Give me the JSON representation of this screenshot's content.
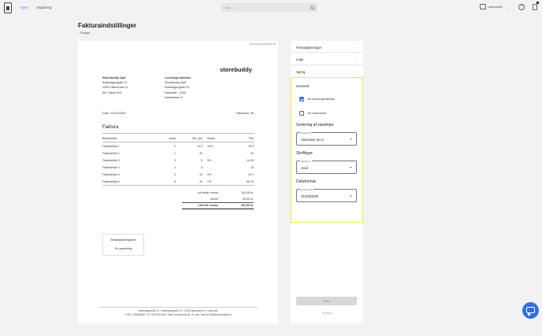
{
  "nav": {
    "home": "Hjem",
    "bookkeeping": "Bogføring",
    "search_placeholder": "Søg....",
    "user": "rasmus98"
  },
  "page": {
    "title": "Fakturaindstillinger",
    "back": "Tilbage"
  },
  "preview": {
    "download_label": "Download preview",
    "brand": "storebuddy",
    "sender": [
      "Storebuddy ApS",
      "Købmagergade 22",
      "1150 København K",
      "Att. Lasse Kirk"
    ],
    "delivery_title": "Leverings adresse",
    "delivery": [
      "Storebuddy ApS",
      "Købmagergade 22",
      "Danmark - 1150",
      "København K"
    ],
    "date": "Dato: 21/12/2025",
    "invoice_no": "Fakturanr. 45",
    "heading": "Faktura",
    "columns": [
      "Beskrivelse",
      "Antal",
      "Stk. pris",
      "Rabat",
      "Pris"
    ],
    "rows": [
      [
        "Fakturalinje 1",
        "2",
        "10.5",
        "10%",
        "18.9"
      ],
      [
        "Fakturalinje 2",
        "1",
        "20",
        "",
        "20"
      ],
      [
        "Fakturalinje 3",
        "3",
        "5",
        "5%",
        "14.25"
      ],
      [
        "Fakturalinje 4",
        "2",
        "5",
        "",
        "10"
      ],
      [
        "Fakturalinje 5",
        "3",
        "10",
        "3%",
        "29.1"
      ],
      [
        "Fakturalinje 6",
        "5",
        "15",
        "7%",
        "69.75"
      ]
    ],
    "totals": [
      {
        "label": "I alt ekskl. moms",
        "value": "162,00 kr."
      },
      {
        "label": "Moms",
        "value": "40,50 kr."
      },
      {
        "label": "I alt inkl. moms",
        "value": "202,50 kr."
      }
    ],
    "terms_title": "Betalingsbetingelser",
    "terms_link": "Se opsætning",
    "footer_line1": "Købmagergade 22 / Købmagergade 22 / 1150 København K / Danmark",
    "footer_line2": "CVR nr 36896668 / Tlf +4527621654 / Web: storebuddy.dk / E-mail: rasmus+98@storebuddy.dk"
  },
  "settings": {
    "sections": [
      "Firmaoplysninger",
      "Logo",
      "Sprog"
    ],
    "general": "Generelt",
    "checkboxes": [
      {
        "label": "Vis leveringsadresse",
        "checked": true
      },
      {
        "label": "Vis varenumre",
        "checked": false
      }
    ],
    "sort_title": "Sortering af varelinjer",
    "sort_label": "Sortering",
    "sort_value": "Varenavn (a-z)",
    "font_title": "Skrifttype",
    "font_label": "Skrifttype",
    "font_value": "Arial",
    "date_title": "Datoformat",
    "date_label": "Datoformat",
    "date_value": "21/03/2025",
    "save": "Gem",
    "cancel": "Fortryd",
    "highlight_color": "#f3ea4a"
  },
  "icons": {
    "search": "search-icon",
    "help": "help-icon",
    "chat": "chat-icon"
  }
}
